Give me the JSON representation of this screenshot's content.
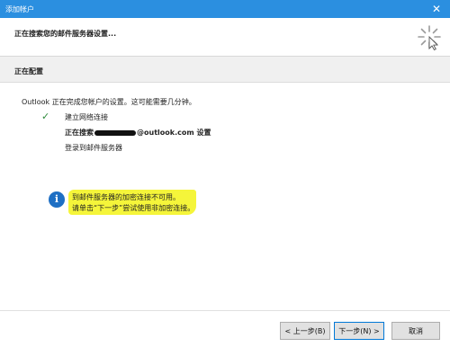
{
  "window": {
    "title": "添加帐户",
    "close_glyph": "✕"
  },
  "header": {
    "heading": "正在搜索您的邮件服务器设置..."
  },
  "section": {
    "title": "正在配置"
  },
  "intro": "Outlook 正在完成您帐户的设置。这可能需要几分钟。",
  "tasks": [
    {
      "label": "建立网络连接",
      "status": "done"
    },
    {
      "label_prefix": "正在搜索",
      "label_suffix": "@outlook.com 设置",
      "status": "in-progress"
    },
    {
      "label": "登录到邮件服务器",
      "status": "pending"
    }
  ],
  "info": {
    "icon_glyph": "i",
    "line1": "到邮件服务器的加密连接不可用。",
    "line2": "请单击“下一步”尝试使用非加密连接。"
  },
  "buttons": {
    "back": "< 上一步(B)",
    "next": "下一步(N) >",
    "cancel": "取消"
  },
  "colors": {
    "titlebar": "#2b8fe0",
    "check": "#2d8a3b",
    "info_icon": "#1e6fc4",
    "highlight": "#f5f53a"
  }
}
